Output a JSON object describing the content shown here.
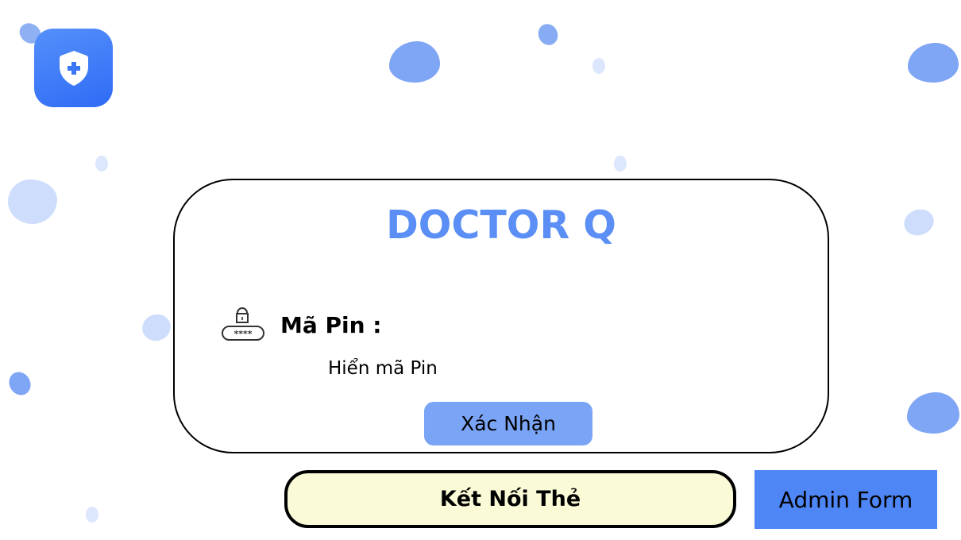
{
  "app": {
    "logo_icon": "shield-plus-icon",
    "title": "DOCTOR Q"
  },
  "pin": {
    "icon": "pin-lock-icon",
    "label": "Mã Pin :",
    "value": "Hiển mã Pin",
    "mask_text": "****"
  },
  "buttons": {
    "confirm_label": "Xác Nhận",
    "connect_card_label": "Kết Nối Thẻ",
    "admin_form_label": "Admin Form"
  },
  "colors": {
    "accent": "#5b8ff5",
    "confirm_bg": "#7aa4f6",
    "connect_bg": "#fafad7",
    "admin_bg": "#4e86f5"
  }
}
